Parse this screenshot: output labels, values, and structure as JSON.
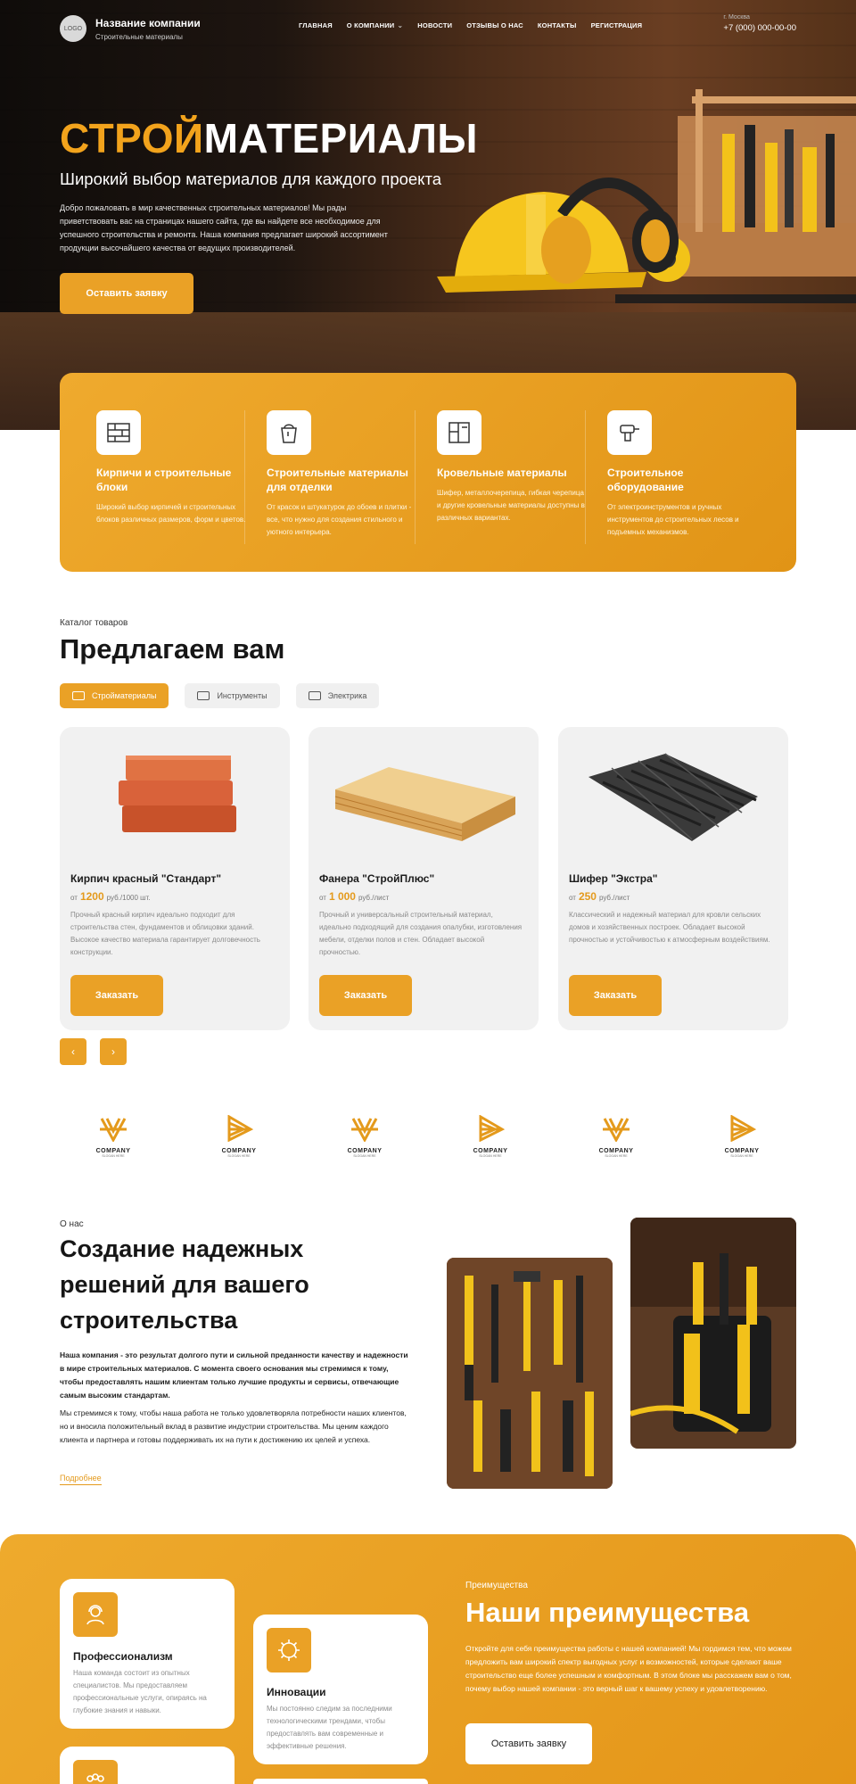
{
  "header": {
    "logo_text": "LOGO",
    "company_name": "Название компании",
    "company_tagline": "Строительные материалы",
    "nav": [
      "ГЛАВНАЯ",
      "О КОМПАНИИ",
      "НОВОСТИ",
      "ОТЗЫВЫ О НАС",
      "КОНТАКТЫ",
      "РЕГИСТРАЦИЯ"
    ],
    "city": "г. Москва",
    "phone": "+7 (000) 000-00-00"
  },
  "hero": {
    "title_accent": "СТРОЙ",
    "title_rest": "МАТЕРИАЛЫ",
    "subtitle": "Широкий выбор материалов для каждого проекта",
    "intro": "Добро пожаловать в мир качественных строительных материалов! Мы рады приветствовать вас на страницах нашего сайта, где вы найдете все необходимое для успешного строительства и ремонта. Наша компания предлагает широкий ассортимент продукции высочайшего качества от ведущих производителей.",
    "cta": "Оставить заявку"
  },
  "categories": [
    {
      "icon": "brick-wall-icon",
      "title": "Кирпичи и строительные блоки",
      "desc": "Широкий выбор кирпичей и строительных блоков различных размеров, форм и цветов."
    },
    {
      "icon": "paint-bucket-icon",
      "title": "Строительные материалы для отделки",
      "desc": "От красок и штукатурок до обоев и плитки - все, что нужно для создания стильного и уютного интерьера."
    },
    {
      "icon": "roof-plan-icon",
      "title": "Кровельные материалы",
      "desc": "Шифер, металлочерепица, гибкая черепица и другие кровельные материалы доступны в различных вариантах."
    },
    {
      "icon": "drill-icon",
      "title": "Строительное оборудование",
      "desc": "От электроинструментов и ручных инструментов до строительных лесов и подъемных механизмов."
    }
  ],
  "catalog": {
    "kicker": "Каталог товаров",
    "title": "Предлагаем вам",
    "tabs": [
      "Стройматериалы",
      "Инструменты",
      "Электрика"
    ],
    "price_prefix": "от",
    "order_label": "Заказать",
    "products": [
      {
        "name": "Кирпич красный \"Стандарт\"",
        "price": "1200",
        "unit": "руб./1000 шт.",
        "desc": "Прочный красный кирпич идеально подходит для строительства стен, фундаментов и облицовки зданий. Высокое качество материала гарантирует долговечность конструкции."
      },
      {
        "name": "Фанера \"СтройПлюс\"",
        "price": "1 000",
        "unit": "руб./лист",
        "desc": "Прочный и универсальный строительный материал, идеально подходящий для создания опалубки, изготовления мебели, отделки полов и стен. Обладает высокой прочностью."
      },
      {
        "name": "Шифер \"Экстра\"",
        "price": "250",
        "unit": "руб./лист",
        "desc": "Классический и надежный материал для кровли сельских домов и хозяйственных построек. Обладает высокой прочностью и устойчивостью к атмосферным воздействиям."
      }
    ],
    "prev": "‹",
    "next": "›"
  },
  "partners": [
    {
      "name": "COMPANY",
      "slogan": "SLOGAN HERE"
    },
    {
      "name": "COMPANY",
      "slogan": "SLOGAN HERE"
    },
    {
      "name": "COMPANY",
      "slogan": "SLOGAN HERE"
    },
    {
      "name": "COMPANY",
      "slogan": "SLOGAN HERE"
    },
    {
      "name": "COMPANY",
      "slogan": "SLOGAN HERE"
    },
    {
      "name": "COMPANY",
      "slogan": "SLOGAN HERE"
    }
  ],
  "about": {
    "kicker": "О нас",
    "title": "Создание надежных решений для вашего строительства",
    "p1": "Наша компания - это результат долгого пути и сильной преданности качеству и надежности в мире строительных материалов. С момента своего основания мы стремимся к тому, чтобы предоставлять нашим клиентам только лучшие продукты и сервисы, отвечающие самым высоким стандартам.",
    "p2": "Мы стремимся к тому, чтобы наша работа не только удовлетворяла потребности наших клиентов, но и вносила положительный вклад в развитие индустрии строительства. Мы ценим каждого клиента и партнера и готовы поддерживать их на пути к достижению их целей и успеха.",
    "more": "Подробнее"
  },
  "advantages": {
    "kicker": "Преимущества",
    "title": "Наши преимущества",
    "text": "Откройте для себя преимущества работы с нашей компанией! Мы гордимся тем, что можем предложить вам широкий спектр выгодных услуг и возможностей, которые сделают ваше строительство еще более успешным и комфортным. В этом блоке мы расскажем вам о том, почему выбор нашей компании - это верный шаг к вашему успеху и удовлетворению.",
    "cta": "Оставить заявку",
    "items": [
      {
        "icon": "worker-icon",
        "title": "Профессионализм",
        "desc": "Наша команда состоит из опытных специалистов. Мы предоставляем профессиональные услуги, опираясь на глубокие знания и навыки."
      },
      {
        "icon": "gear-bulb-icon",
        "title": "Инновации",
        "desc": "Мы постоянно следим за последними технологическими трендами, чтобы предоставлять вам современные и эффективные решения."
      }
    ]
  },
  "colors": {
    "accent": "#eaa126",
    "dark": "#161616"
  }
}
